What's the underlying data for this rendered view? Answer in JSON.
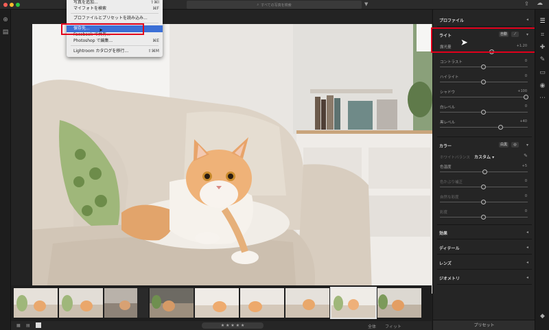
{
  "search": {
    "placeholder": "すべての写真を検索"
  },
  "menu": {
    "items": [
      {
        "label": "写真を追加...",
        "shortcut": "⇧⌘I"
      },
      {
        "label": "マイフォトを検索",
        "shortcut": "⌘F"
      },
      {
        "label": "プロファイルとプリセットを読み込み...",
        "shortcut": ""
      },
      {
        "label": "保存先...",
        "shortcut": ""
      },
      {
        "label": "Facebook で共有...",
        "shortcut": ""
      },
      {
        "label": "Photoshop で編集...",
        "shortcut": "⌘E"
      },
      {
        "label": "Lightroom カタログを移行...",
        "shortcut": "⇧⌘M"
      }
    ]
  },
  "panel": {
    "profile_label": "プロファイル",
    "light": {
      "title": "ライト",
      "auto_label": "自動",
      "sliders": [
        {
          "label": "露光量",
          "value": "+1.20",
          "pos": 0.6
        },
        {
          "label": "コントラスト",
          "value": "0",
          "pos": 0.5
        },
        {
          "label": "ハイライト",
          "value": "0",
          "pos": 0.5
        },
        {
          "label": "シャドウ",
          "value": "+100",
          "pos": 1.0
        },
        {
          "label": "白レベル",
          "value": "0",
          "pos": 0.5
        },
        {
          "label": "黒レベル",
          "value": "+40",
          "pos": 0.7
        }
      ]
    },
    "color": {
      "title": "カラー",
      "bw_label": "白黒",
      "wb_label": "ホワイトバランス",
      "wb_value": "カスタム",
      "sliders": [
        {
          "label": "色温度",
          "value": "+5",
          "pos": 0.52,
          "dim": false
        },
        {
          "label": "色かぶり補正",
          "value": "0",
          "pos": 0.5,
          "dim": true
        },
        {
          "label": "自然な彩度",
          "value": "0",
          "pos": 0.5,
          "dim": true
        },
        {
          "label": "彩度",
          "value": "0",
          "pos": 0.5,
          "dim": true
        }
      ]
    },
    "sections": [
      "効果",
      "ディテール",
      "レンズ",
      "ジオメトリ"
    ],
    "preset_label": "プリセット"
  },
  "bottombar": {
    "fit_label": "全体",
    "zoom_label": "フィット"
  },
  "filmstrip": {
    "count": 9,
    "selected_index": 7
  },
  "colors": {
    "accent": "#3b6fd6",
    "annotation": "#e3001b",
    "panel_bg": "#252525"
  }
}
